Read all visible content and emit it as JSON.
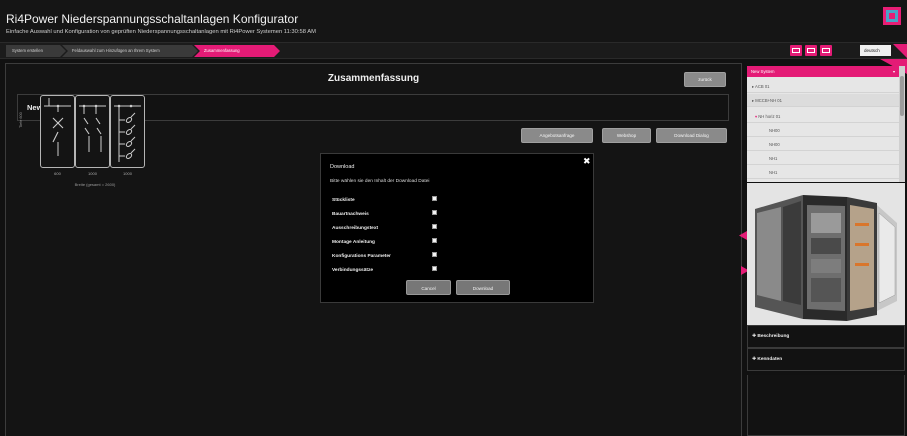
{
  "app": {
    "title": "Ri4Power Niederspannungsschaltanlagen Konfigurator",
    "subtitle": "Einfache Auswahl und Konfiguration von geprüften Niederspannungsschaltanlagen mit Ri4Power Systemen 11:30:58 AM"
  },
  "breadcrumb": [
    {
      "label": "System erstellen"
    },
    {
      "label": "Feldauswahl zum Hinzufügen an Ihrem System"
    },
    {
      "label": "Zusammenfassung",
      "active": true
    }
  ],
  "toolbar": {
    "icons": [
      "save-icon",
      "save-as-icon",
      "export-icon"
    ],
    "language": "deutsch"
  },
  "main": {
    "title": "Zusammenfassung",
    "back_button": "zurück",
    "system_name": "New System",
    "actions": [
      "Angebotsanfrage",
      "Webshop",
      "Download Dialog"
    ],
    "cabinets": [
      {
        "label": "600"
      },
      {
        "label": "1000"
      },
      {
        "label": "1000"
      }
    ],
    "total_width": "Breite (gesamt = 2600)",
    "side_label": "Tiefe 600"
  },
  "modal": {
    "title": "Download",
    "close": "✖",
    "description": "Bitte wählen sie den Inhalt der Download Datei",
    "options": [
      {
        "label": "Stückliste",
        "checked": false
      },
      {
        "label": "Bauartnachweis",
        "checked": false
      },
      {
        "label": "Ausschreibungstext",
        "checked": false
      },
      {
        "label": "Montage Anleitung",
        "checked": false
      },
      {
        "label": "Konfigurations Parameter",
        "checked": false
      },
      {
        "label": "Verbindungssätze",
        "checked": false
      }
    ],
    "cancel": "Cancel",
    "download": "Download"
  },
  "sidebar": {
    "tree_header": "New System",
    "tree": [
      {
        "label": "ACB 01",
        "indent": 0,
        "marker": "▸"
      },
      {
        "label": "MCCB+NH 01",
        "indent": 0,
        "marker": "▸"
      },
      {
        "label": "NH horiz 01",
        "indent": 0,
        "marker": "▾"
      },
      {
        "label": "NH00",
        "indent": 1,
        "marker": ""
      },
      {
        "label": "NH00",
        "indent": 1,
        "marker": ""
      },
      {
        "label": "NH1",
        "indent": 1,
        "marker": ""
      },
      {
        "label": "NH1",
        "indent": 1,
        "marker": ""
      }
    ],
    "accordion": [
      {
        "label": "Beschreibung"
      },
      {
        "label": "Kenndaten"
      }
    ]
  },
  "colors": {
    "accent": "#e41b76",
    "background": "#111111",
    "button": "#8a8a8a"
  }
}
